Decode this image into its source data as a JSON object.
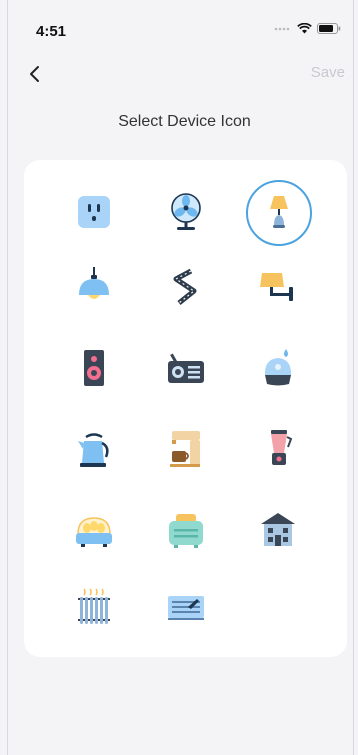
{
  "status_bar": {
    "time": "4:51"
  },
  "nav": {
    "save_label": "Save"
  },
  "page": {
    "title": "Select Device Icon"
  },
  "icons": [
    {
      "name": "smart-plug-icon",
      "selected": false
    },
    {
      "name": "fan-icon",
      "selected": false
    },
    {
      "name": "table-lamp-icon",
      "selected": true
    },
    {
      "name": "ceiling-lamp-icon",
      "selected": false
    },
    {
      "name": "light-strip-icon",
      "selected": false
    },
    {
      "name": "wall-lamp-icon",
      "selected": false
    },
    {
      "name": "speaker-icon",
      "selected": false
    },
    {
      "name": "radio-icon",
      "selected": false
    },
    {
      "name": "humidifier-icon",
      "selected": false
    },
    {
      "name": "kettle-icon",
      "selected": false
    },
    {
      "name": "coffee-maker-icon",
      "selected": false
    },
    {
      "name": "blender-icon",
      "selected": false
    },
    {
      "name": "egg-cooker-icon",
      "selected": false
    },
    {
      "name": "toaster-icon",
      "selected": false
    },
    {
      "name": "building-icon",
      "selected": false
    },
    {
      "name": "radiator-icon",
      "selected": false
    },
    {
      "name": "air-conditioner-icon",
      "selected": false
    }
  ],
  "colors": {
    "selected_ring": "#4aa3df",
    "save_disabled": "#c9c9cf"
  }
}
